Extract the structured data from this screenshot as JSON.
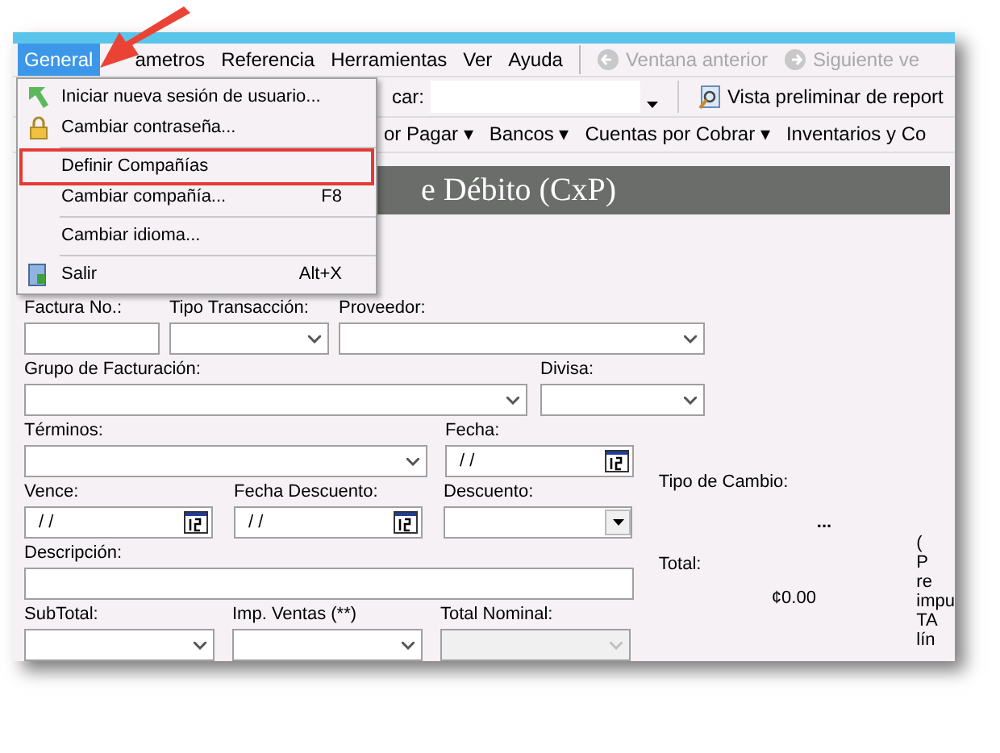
{
  "menu_bar": [
    {
      "label": "General",
      "selected": true
    },
    {
      "label": "ametros",
      "selected": false
    },
    {
      "label": "Referencia",
      "selected": false
    },
    {
      "label": "Herramientas",
      "selected": false
    },
    {
      "label": "Ver",
      "selected": false
    },
    {
      "label": "Ayuda",
      "selected": false
    }
  ],
  "nav_buttons": [
    {
      "label": "Ventana anterior",
      "disabled": true,
      "kind": "back"
    },
    {
      "label": "Siguiente ve",
      "disabled": true,
      "kind": "forward"
    }
  ],
  "toolbar": {
    "search_label": "car:",
    "preview_label": "Vista preliminar de report"
  },
  "module_menus": [
    "or Pagar ▾",
    "Bancos ▾",
    "Cuentas por Cobrar ▾",
    "Inventarios y Co"
  ],
  "general_menu": [
    {
      "kind": "item",
      "label": "Iniciar nueva sesión de usuario...",
      "highlighted": false
    },
    {
      "kind": "item",
      "label": "Cambiar contraseña...",
      "highlighted": false
    },
    {
      "kind": "separator"
    },
    {
      "kind": "item",
      "label": "Definir Compañías",
      "highlighted": true
    },
    {
      "kind": "item",
      "label": "Cambiar compañía...",
      "shortcut": "F8",
      "highlighted": false
    },
    {
      "kind": "separator"
    },
    {
      "kind": "item",
      "label": "Cambiar idioma...",
      "highlighted": false
    },
    {
      "kind": "separator"
    },
    {
      "kind": "item",
      "label": "Salir",
      "shortcut": "Alt+X",
      "highlighted": false
    }
  ],
  "form": {
    "title": "e Débito (CxP)",
    "row_1": [
      {
        "label": "Factura No.:",
        "kind": "text"
      },
      {
        "label": "Tipo Transacción:",
        "kind": "combo"
      },
      {
        "label": "Proveedor:",
        "kind": "combo"
      }
    ],
    "row_2": [
      {
        "label": "Grupo de Facturación:",
        "kind": "combo"
      },
      {
        "label": "Divisa:",
        "kind": "combo"
      }
    ],
    "row_3": [
      {
        "label": "Términos:",
        "kind": "combo"
      },
      {
        "label": "Fecha:",
        "kind": "date",
        "value": "/ /"
      }
    ],
    "row_4": [
      {
        "label": "Vence:",
        "kind": "date",
        "value": "/ /"
      },
      {
        "label": "Fecha Descuento:",
        "kind": "date",
        "value": "/ /"
      },
      {
        "label": "Descuento:",
        "kind": "dropdown"
      }
    ],
    "row_5": [
      {
        "label": "Descripción:",
        "kind": "text"
      }
    ],
    "row_6": [
      {
        "label": "SubTotal:",
        "kind": "combo"
      },
      {
        "label": "Imp. Ventas (**)",
        "kind": "combo"
      },
      {
        "label": "Total Nominal:",
        "kind": "combo",
        "disabled": true
      }
    ],
    "exchange_label": "Tipo de Cambio:",
    "exchange_value": "...",
    "total_label": "Total:",
    "total_value": "¢0.00",
    "side_note": [
      "(",
      "P",
      "re",
      "impu",
      "TA",
      "lín"
    ]
  }
}
